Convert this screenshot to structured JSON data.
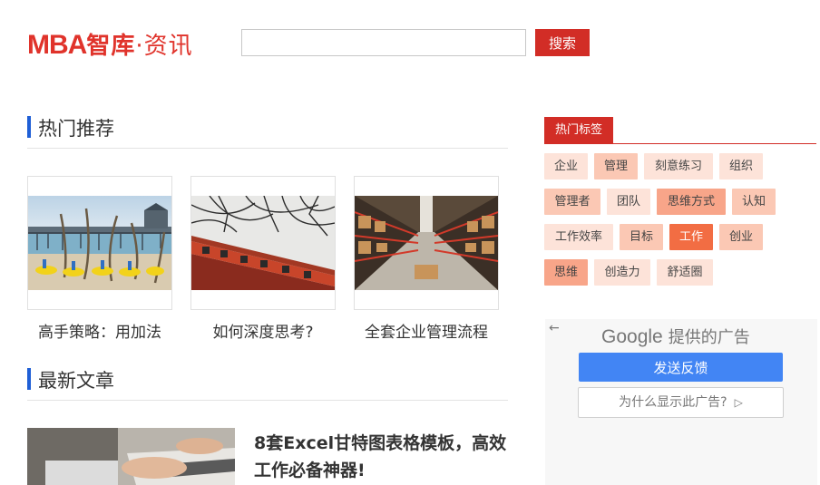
{
  "header": {
    "logo_mba": "MBA",
    "logo_zhiku": "智库",
    "logo_zixun": "·资讯",
    "search_placeholder": "",
    "search_button": "搜索"
  },
  "hot": {
    "title": "热门推荐",
    "items": [
      {
        "title": "高手策略：用加法"
      },
      {
        "title": "如何深度思考?"
      },
      {
        "title": "全套企业管理流程"
      }
    ]
  },
  "latest": {
    "title": "最新文章",
    "items": [
      {
        "title": "8套Excel甘特图表格模板，高效工作必备神器!"
      }
    ]
  },
  "tags": {
    "title": "热门标签",
    "items": [
      {
        "label": "企业",
        "color": "#fde3d9"
      },
      {
        "label": "管理",
        "color": "#fbc8b4"
      },
      {
        "label": "刻意练习",
        "color": "#fde3d9"
      },
      {
        "label": "组织",
        "color": "#fde3d9"
      },
      {
        "label": "管理者",
        "color": "#fbc8b4"
      },
      {
        "label": "团队",
        "color": "#fde3d9"
      },
      {
        "label": "思维方式",
        "color": "#f8a589"
      },
      {
        "label": "认知",
        "color": "#fbc8b4"
      },
      {
        "label": "工作效率",
        "color": "#fde3d9"
      },
      {
        "label": "目标",
        "color": "#fbc8b4"
      },
      {
        "label": "工作",
        "color": "#f26d43"
      },
      {
        "label": "创业",
        "color": "#fbc8b4"
      },
      {
        "label": "思维",
        "color": "#f8a589"
      },
      {
        "label": "创造力",
        "color": "#fde3d9"
      },
      {
        "label": "舒适圈",
        "color": "#fde3d9"
      }
    ]
  },
  "ad": {
    "back": "←",
    "brand": "Google",
    "provided": "提供的广告",
    "feedback": "发送反馈",
    "why": "为什么显示此广告?",
    "why_icon": "▷"
  },
  "colors": {
    "brand_red": "#d22d26",
    "accent_blue": "#1f5fd6",
    "google_blue": "#4285f4"
  }
}
